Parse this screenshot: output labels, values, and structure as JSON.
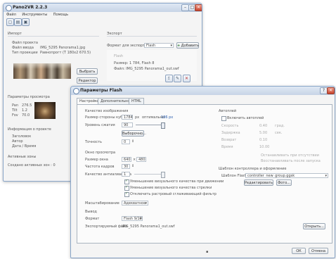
{
  "main_window": {
    "title": "Pano2VR 2.2.3",
    "menu": [
      "Файл",
      "Инструменты",
      "Помощь"
    ],
    "input_section": {
      "heading": "Импорт",
      "rows": [
        {
          "label": "Файл проекта",
          "value": ""
        },
        {
          "label": "Файл ввода",
          "value": "IMG_5295 Panorama1.jpg"
        },
        {
          "label": "Тип проекции",
          "value": "Равнопрогт (T 180x2 670.5)"
        }
      ],
      "select_button": "Выбрать",
      "edit_button": "Редактор"
    },
    "output_section": {
      "heading": "Экспорт",
      "format_label": "Формат для экспорта",
      "format_value": "Flash",
      "add_button": "Добавить",
      "list_title": "Flash",
      "list_size": "Размер: 1 784, Flash 8",
      "list_file": "Файл: IMG_5295 Panorama1_out.swf"
    },
    "viewing_params": {
      "heading": "Параметры просмотра",
      "rows": [
        {
          "label": "Pan",
          "value": "276.5"
        },
        {
          "label": "Tilt",
          "value": "1.2"
        },
        {
          "label": "Fov",
          "value": "70.0"
        }
      ]
    },
    "project_info": {
      "heading": "Информация о проекте",
      "rows": [
        "Заголовок",
        "Автор",
        "Дата / Время"
      ]
    },
    "active_zones": {
      "heading": "Активные зоны",
      "create_label": "Создано активных зон : 0"
    }
  },
  "flash_dialog": {
    "title": "Параметры Flash",
    "tabs": [
      "Настройки",
      "Дополнительно",
      "HTML"
    ],
    "quality_heading": "Качество изображения",
    "cube_size_label": "Размер стороны куба",
    "cube_size_value": "1784",
    "cube_size_unit": "px",
    "optimal_label": "оптимально:",
    "optimal_value": "186 px",
    "compression_label": "Уровень сжатия",
    "compression_value": "90",
    "selection_button": "Выборочно...",
    "sharpness_label": "Точность",
    "sharpness_value": "0",
    "window_heading": "Окно просмотра",
    "window_size_label": "Размер окна",
    "window_width": "640",
    "window_height": "480",
    "fps_label": "Частота кадров",
    "fps_value": "30",
    "aa_label": "Качество антиалиасинга",
    "aa_value": "1",
    "options": [
      {
        "label": "Уменьшение визуального качества при движении",
        "checked": true
      },
      {
        "label": "Уменьшение визуального качества стрелки",
        "checked": true
      },
      {
        "label": "Отключить растровый сглаживающий фильтр",
        "checked": true
      }
    ],
    "scaling_label": "Масштабирование",
    "scaling_value": "Адекватное",
    "output_heading": "Вывод",
    "format_label": "Формат",
    "format_value": "Flash 9/10",
    "output_file_label": "Экспортируемый файл",
    "output_file_value": "IMG_5295 Panorama1_out.swf",
    "open_button": "Открыть...",
    "autoplay_heading": "Автоплей",
    "autoplay_enable": "Включить автоплей",
    "autoplay_rows": [
      {
        "label": "Скорость",
        "value": "0.40",
        "unit": "град."
      },
      {
        "label": "Задержка",
        "value": "5.00",
        "unit": "сек."
      },
      {
        "label": "Возврат",
        "value": "0.10",
        "unit": ""
      },
      {
        "label": "Время",
        "value": "10.00",
        "unit": ""
      }
    ],
    "autoplay_extra": [
      "Останавливать при отсутствии",
      "Восстанавливать после запуска"
    ],
    "skin_heading": "Шаблон контроллера и оформление",
    "skin_label": "Шаблон Flash 8",
    "skin_value": "controller_new_group.ggsk",
    "skin_edit_button": "Редактировать",
    "skin_browse_button": "Фото...",
    "ok_button": "ОК",
    "cancel_button": "Отмена",
    "help_icon": "?"
  },
  "colors": {
    "titlebar": "#c7d4e6",
    "accent": "#2b5fb0",
    "close": "#c8432c"
  }
}
